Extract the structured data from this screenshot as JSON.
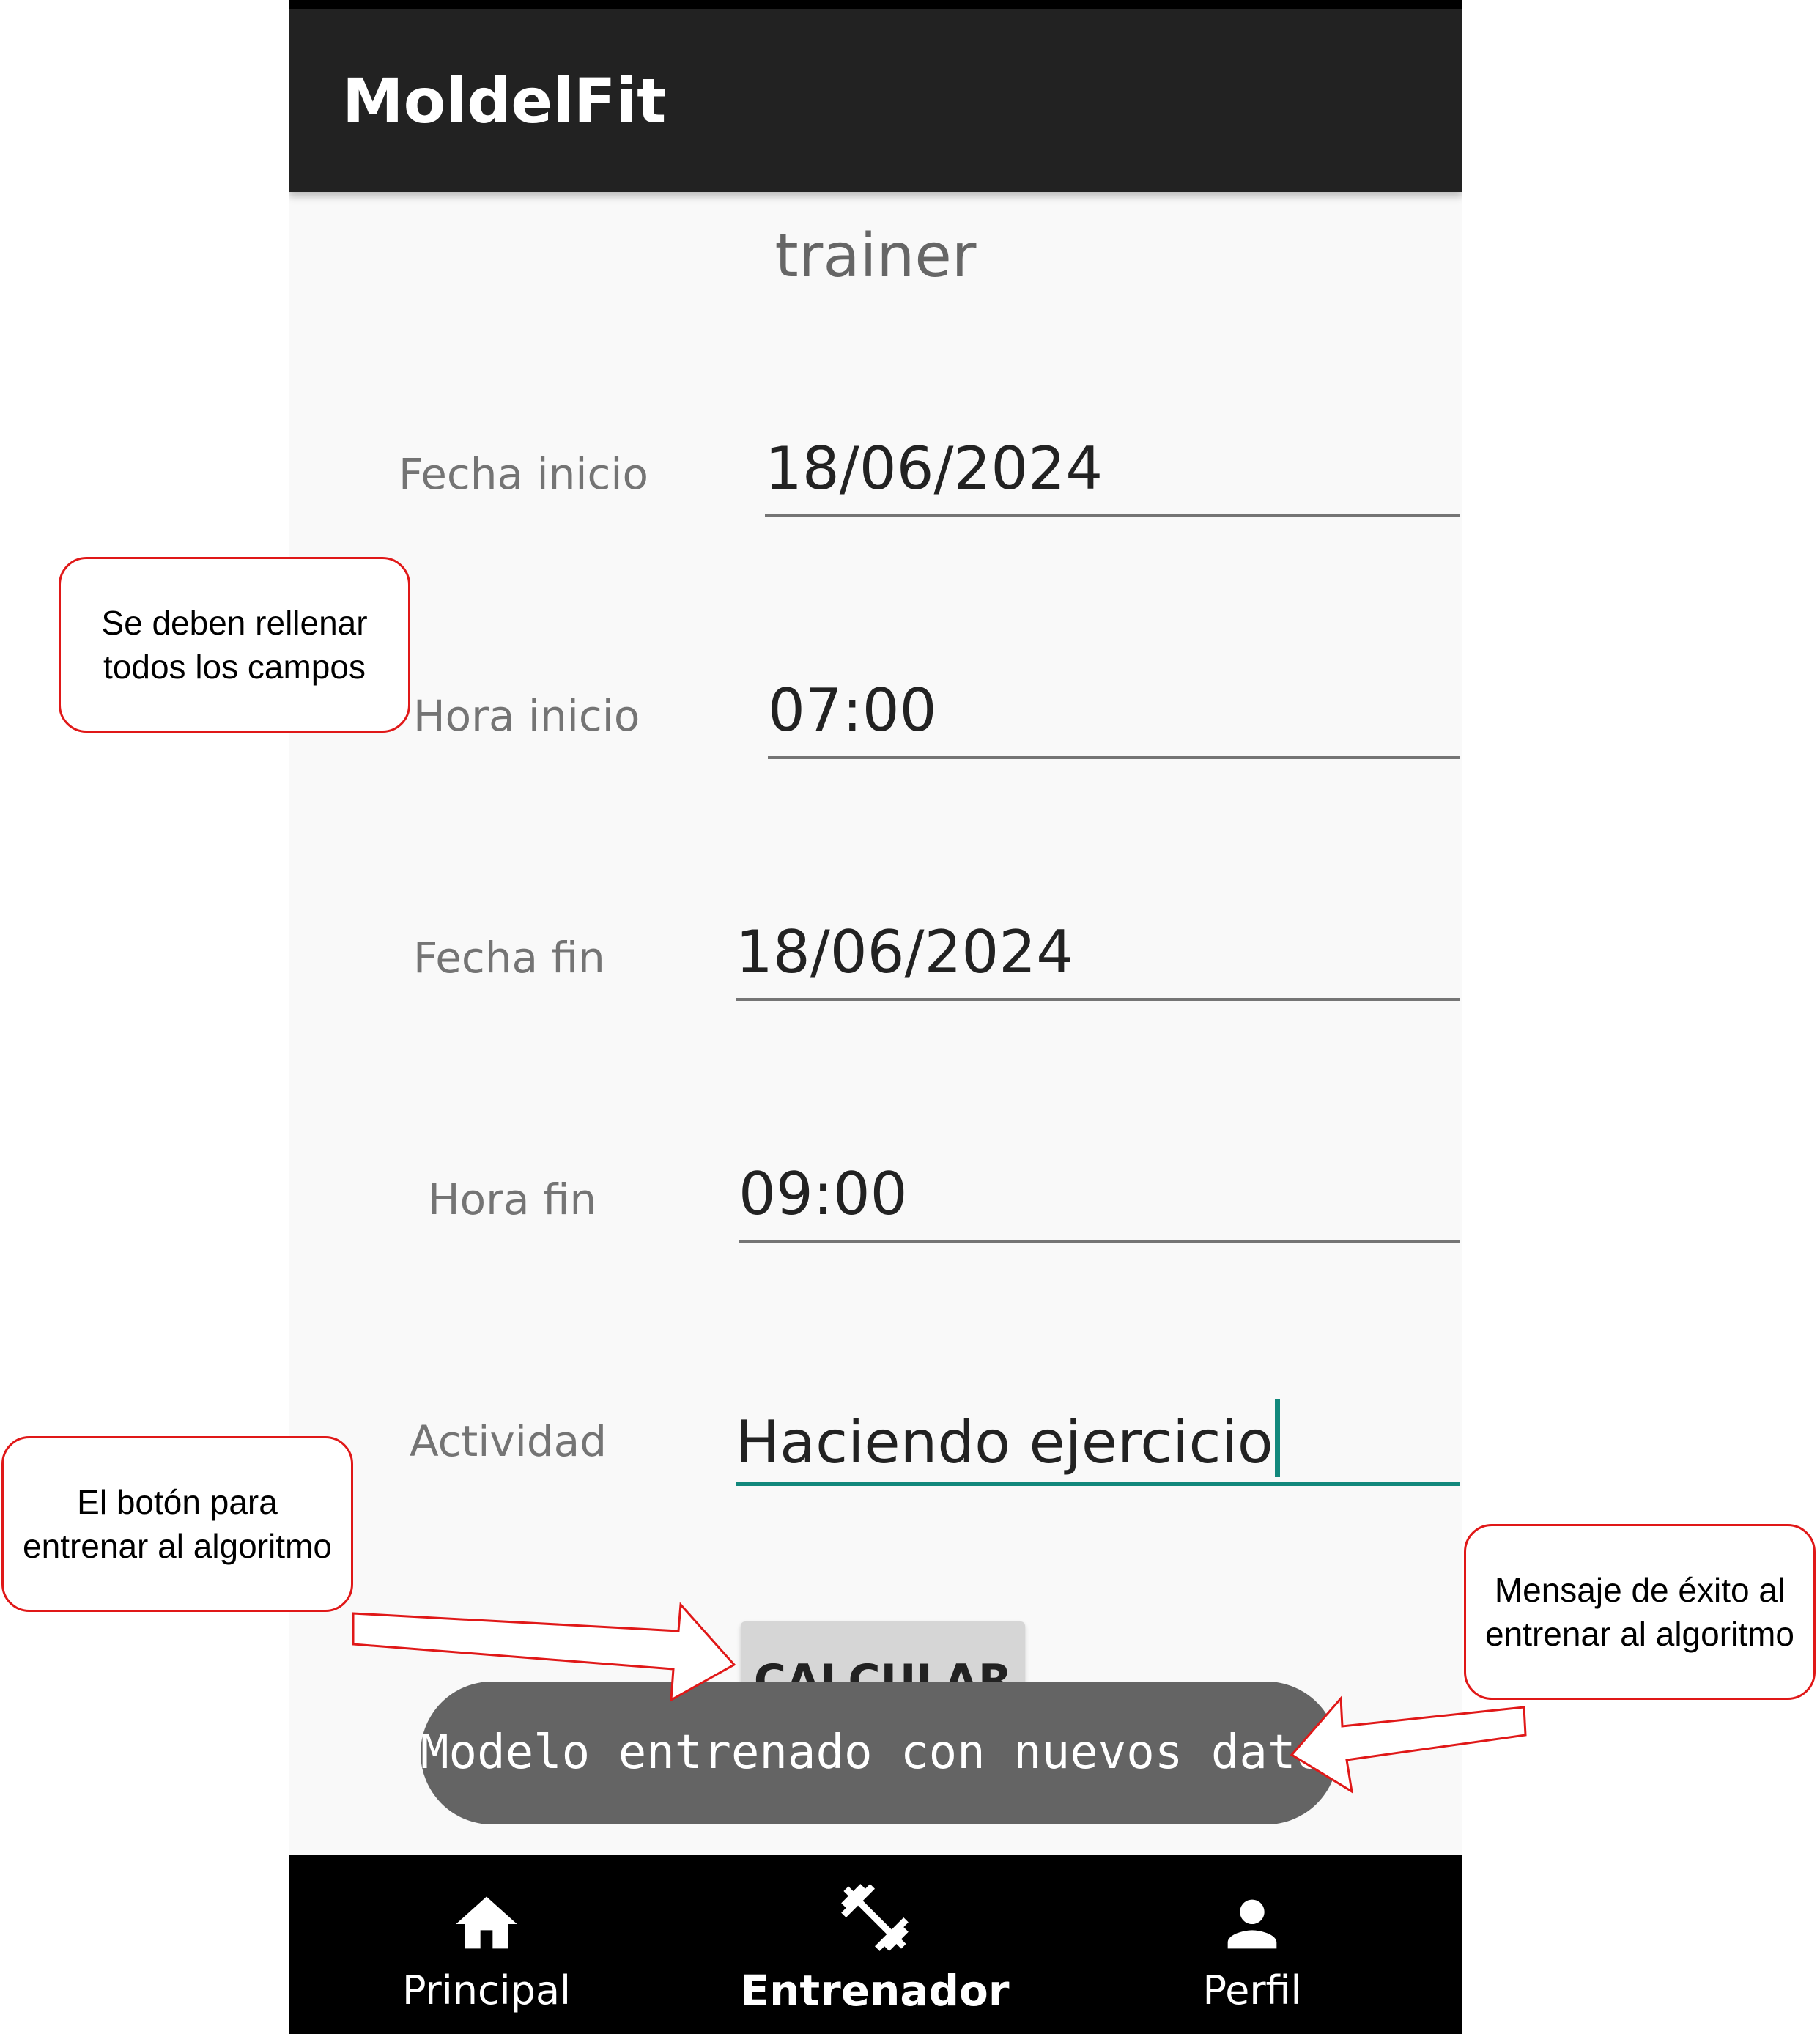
{
  "app": {
    "title": "MoldelFit"
  },
  "screen": {
    "title": "trainer"
  },
  "form": {
    "fecha_inicio": {
      "label": "Fecha inicio",
      "value": "18/06/2024"
    },
    "hora_inicio": {
      "label": "Hora inicio",
      "value": "07:00"
    },
    "fecha_fin": {
      "label": "Fecha fin",
      "value": "18/06/2024"
    },
    "hora_fin": {
      "label": "Hora fin",
      "value": "09:00"
    },
    "actividad": {
      "label": "Actividad",
      "value": "Haciendo ejercicio"
    }
  },
  "button": {
    "calcular": "CALCULAR"
  },
  "toast": {
    "message": "Modelo entrenado con nuevos datos"
  },
  "nav": {
    "items": [
      {
        "label": "Principal",
        "icon": "home-icon",
        "active": false
      },
      {
        "label": "Entrenador",
        "icon": "dumbbell-icon",
        "active": true
      },
      {
        "label": "Perfil",
        "icon": "person-icon",
        "active": false
      }
    ]
  },
  "callouts": {
    "campos": [
      "Se deben rellenar",
      "todos los campos"
    ],
    "boton": [
      "El botón para",
      "entrenar al algoritmo"
    ],
    "mensaje": [
      "Mensaje de éxito al",
      "entrenar al algoritmo"
    ]
  },
  "colors": {
    "appbar": "#222222",
    "accent": "#12887c",
    "callout_border": "#e01818",
    "toast": "#646464",
    "nav_bg": "#000000"
  }
}
